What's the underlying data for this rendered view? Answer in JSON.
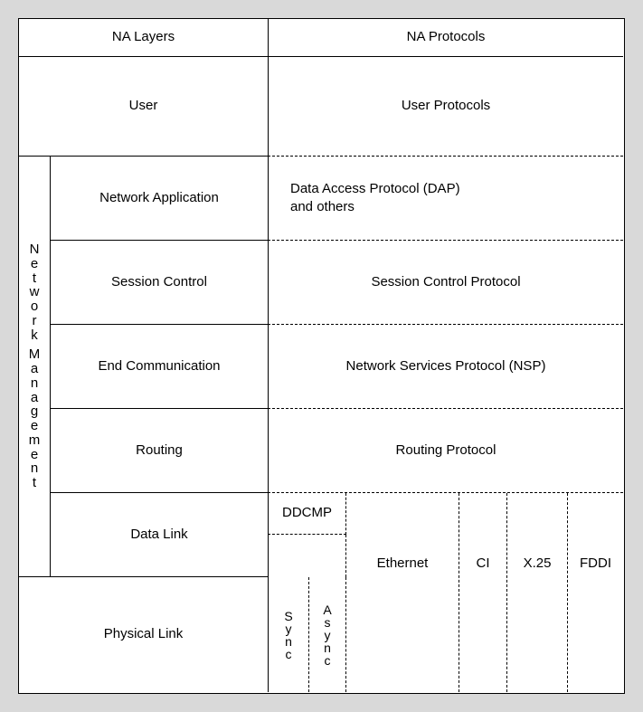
{
  "header": {
    "left": "NA Layers",
    "right": "NA Protocols"
  },
  "sidebar": {
    "label": "Network Management"
  },
  "rows": {
    "user": {
      "layer": "User",
      "protocol": "User Protocols"
    },
    "netapp": {
      "layer": "Network Application",
      "protocol": "Data Access Protocol (DAP)\nand others"
    },
    "session": {
      "layer": "Session Control",
      "protocol": "Session Control Protocol"
    },
    "endcomm": {
      "layer": "End Communication",
      "protocol": "Network Services Protocol (NSP)"
    },
    "routing": {
      "layer": "Routing",
      "protocol": "Routing Protocol"
    },
    "datalink": {
      "layer": "Data Link"
    },
    "physical": {
      "layer": "Physical Link"
    }
  },
  "lower_protocols": {
    "ddcmp": "DDCMP",
    "sync": "Sync",
    "async": "Async",
    "ethernet": "Ethernet",
    "ci": "CI",
    "x25": "X.25",
    "fddi": "FDDI"
  }
}
